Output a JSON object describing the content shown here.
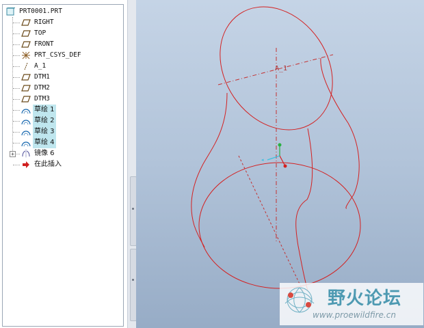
{
  "model_tree": {
    "root": {
      "label": "PRT0001.PRT",
      "icon": "part-icon"
    },
    "items": [
      {
        "label": "RIGHT",
        "icon": "datum-plane-icon",
        "highlighted": false
      },
      {
        "label": "TOP",
        "icon": "datum-plane-icon",
        "highlighted": false
      },
      {
        "label": "FRONT",
        "icon": "datum-plane-icon",
        "highlighted": false
      },
      {
        "label": "PRT_CSYS_DEF",
        "icon": "coordinate-system-icon",
        "highlighted": false
      },
      {
        "label": "A_1",
        "icon": "datum-axis-icon",
        "highlighted": false
      },
      {
        "label": "DTM1",
        "icon": "datum-plane-icon",
        "highlighted": false
      },
      {
        "label": "DTM2",
        "icon": "datum-plane-icon",
        "highlighted": false
      },
      {
        "label": "DTM3",
        "icon": "datum-plane-icon",
        "highlighted": false
      },
      {
        "label": "草绘 1",
        "icon": "sketch-icon",
        "highlighted": true
      },
      {
        "label": "草绘 2",
        "icon": "sketch-icon",
        "highlighted": true
      },
      {
        "label": "草绘 3",
        "icon": "sketch-icon",
        "highlighted": true
      },
      {
        "label": "草绘 4",
        "icon": "sketch-icon",
        "highlighted": true
      },
      {
        "label": "镜像 6",
        "icon": "mirror-icon",
        "highlighted": false,
        "expandable": true
      },
      {
        "label": "在此插入",
        "icon": "insert-here-arrow-icon",
        "highlighted": false
      }
    ]
  },
  "viewport": {
    "axis_label": "A_1",
    "background_top": "#c5d4e6",
    "background_bottom": "#97acc6",
    "curve_color": "#d42020"
  },
  "watermark": {
    "title": "野火论坛",
    "url": "www.proewildfire.cn"
  }
}
